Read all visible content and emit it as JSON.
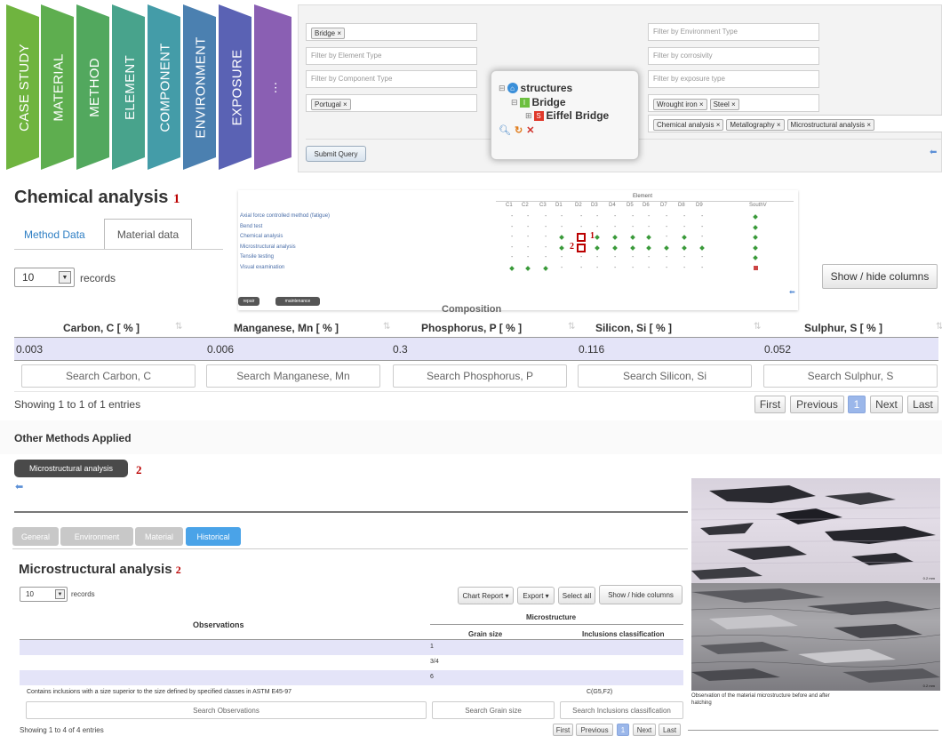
{
  "flow": {
    "steps": [
      "CASE STUDY",
      "MATERIAL",
      "METHOD",
      "ELEMENT",
      "COMPONENT",
      "ENVIRONMENT",
      "EXPOSURE",
      "..."
    ],
    "colors": [
      "#6fb43f",
      "#5eae4f",
      "#52a85e",
      "#48a38c",
      "#449ca8",
      "#4b80b0",
      "#5a62b4",
      "#8a5fb3"
    ]
  },
  "query": {
    "left": {
      "structure_tag": "Bridge",
      "element_placeholder": "Filter by Element Type",
      "component_placeholder": "Filter by Component Type",
      "country_tag": "Portugal"
    },
    "right": {
      "environment_placeholder": "Filter by Environment Type",
      "corrosivity_placeholder": "Filter by corrosivity",
      "exposure_placeholder": "Filter by exposure type",
      "material_tags": [
        "Wrought iron",
        "Steel"
      ],
      "method_tags": [
        "Chemical analysis",
        "Metallography",
        "Microstructural analysis"
      ]
    },
    "tree": {
      "root": "structures",
      "child": "Bridge",
      "grandchild": "Eiffel Bridge",
      "child_badge": "I",
      "grandchild_badge": "S"
    },
    "submit_label": "Submit Query"
  },
  "chem": {
    "title": "Chemical analysis",
    "marker": "1",
    "tabs": {
      "method": "Method Data",
      "material": "Material data"
    },
    "records_value": "10",
    "records_label": "records",
    "show_hide": "Show / hide columns",
    "composition_label": "Composition",
    "headers": [
      "Carbon, C [ % ]",
      "Manganese, Mn [ % ]",
      "Phosphorus, P [ % ]",
      "Silicon, Si [ % ]",
      "Sulphur, S [ % ]"
    ],
    "row": [
      "0.003",
      "0.006",
      "0.3",
      "0.116",
      "0.052"
    ],
    "search": [
      "Search Carbon, C",
      "Search Manganese, Mn",
      "Search Phosphorus, P",
      "Search Silicon, Si",
      "Search Sulphur, S"
    ],
    "showing": "Showing 1 to 1 of 1 entries",
    "pager": {
      "first": "First",
      "previous": "Previous",
      "page": "1",
      "next": "Next",
      "last": "Last"
    }
  },
  "matrix": {
    "group_label": "Element",
    "columns": [
      "C1",
      "C2",
      "C3",
      "D1",
      "D2",
      "D3",
      "D4",
      "D5",
      "D6",
      "D7",
      "D8",
      "D9",
      "SouthV"
    ],
    "rows": [
      {
        "label": "Axial force controlled method (fatigue)",
        "cells": [
          "-",
          "-",
          "-",
          "-",
          "-",
          "-",
          "-",
          "-",
          "-",
          "-",
          "-",
          "-",
          "d"
        ]
      },
      {
        "label": "Bend test",
        "cells": [
          "-",
          "-",
          "-",
          "-",
          "-",
          "-",
          "-",
          "-",
          "-",
          "-",
          "-",
          "-",
          "d"
        ]
      },
      {
        "label": "Chemical analysis",
        "cells": [
          "-",
          "-",
          "-",
          "d",
          "s",
          "d",
          "d",
          "d",
          "d",
          "-",
          "d",
          "-",
          "d"
        ]
      },
      {
        "label": "Microstructural analysis",
        "cells": [
          "-",
          "-",
          "-",
          "d",
          "s",
          "d",
          "d",
          "d",
          "d",
          "d",
          "d",
          "d",
          "d"
        ]
      },
      {
        "label": "Tensile testing",
        "cells": [
          "-",
          "-",
          "-",
          "-",
          "-",
          "-",
          "-",
          "-",
          "-",
          "-",
          "-",
          "-",
          "d"
        ]
      },
      {
        "label": "Visual examination",
        "cells": [
          "d",
          "d",
          "d",
          "-",
          "-",
          "-",
          "-",
          "-",
          "-",
          "-",
          "-",
          "-",
          "r"
        ]
      }
    ],
    "marks": [
      "1",
      "2"
    ],
    "buttons": [
      "repair",
      "maintenance"
    ]
  },
  "other": {
    "heading": "Other Methods Applied",
    "button": "Microstructural analysis",
    "marker": "2"
  },
  "micro": {
    "tabs": [
      "General",
      "Environment",
      "Material",
      "Historical"
    ],
    "title": "Microstructural analysis",
    "marker": "2",
    "records_value": "10",
    "records_label": "records",
    "toolbar": [
      "Chart Report ▾",
      "Export ▾",
      "Select all",
      "Show / hide columns"
    ],
    "col_observations": "Observations",
    "col_group": "Microstructure",
    "col_grain": "Grain size",
    "col_inclusions": "Inclusions classification",
    "rows": [
      {
        "obs": "",
        "grain": "1",
        "incl": ""
      },
      {
        "obs": "",
        "grain": "3/4",
        "incl": ""
      },
      {
        "obs": "",
        "grain": "6",
        "incl": ""
      },
      {
        "obs": "Contains inclusions with a size superior to the size defined by specified classes in ASTM E45-97",
        "grain": "",
        "incl": "C(G5,F2)"
      }
    ],
    "search": [
      "Search Observations",
      "Search Grain size",
      "Search Inclusions classification"
    ],
    "showing": "Showing 1 to 4 of 4 entries",
    "pager": {
      "first": "First",
      "previous": "Previous",
      "page": "1",
      "next": "Next",
      "last": "Last"
    }
  },
  "photo": {
    "caption": "Observation of the material microstructure before and after hatching",
    "scale": "0.2 mm"
  }
}
